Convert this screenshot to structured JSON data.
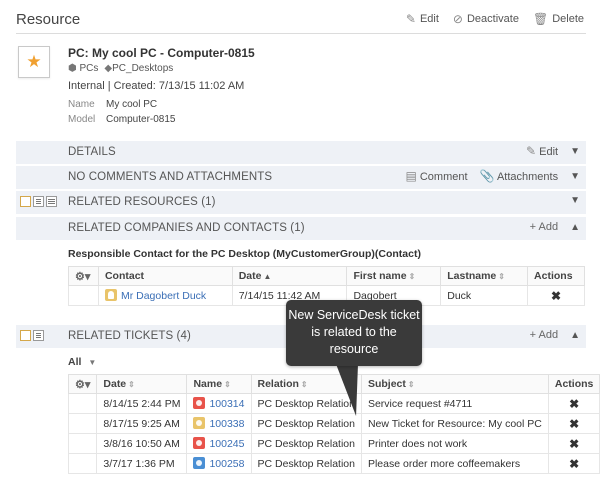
{
  "header": {
    "title": "Resource",
    "edit": "Edit",
    "deactivate": "Deactivate",
    "delete": "Delete"
  },
  "resource": {
    "title": "PC: My cool PC - Computer-0815",
    "crumb1": "PCs",
    "crumb2": "PC_Desktops",
    "meta": "Internal | Created: 7/13/15 11:02 AM",
    "name_label": "Name",
    "name_value": "My cool PC",
    "model_label": "Model",
    "model_value": "Computer-0815"
  },
  "sections": {
    "details": "DETAILS",
    "details_edit": "Edit",
    "comments": "NO COMMENTS AND ATTACHMENTS",
    "comment_btn": "Comment",
    "attachments_btn": "Attachments",
    "related_resources": "RELATED RESOURCES (1)",
    "related_companies": "RELATED COMPANIES AND CONTACTS (1)",
    "add": "+ Add",
    "related_tickets": "RELATED TICKETS (4)"
  },
  "contacts": {
    "subhead": "Responsible Contact for the PC Desktop (MyCustomerGroup)(Contact)",
    "columns": [
      "Contact",
      "Date",
      "First name",
      "Lastname",
      "Actions"
    ],
    "rows": [
      {
        "contact": "Mr Dagobert Duck",
        "date": "7/14/15 11:42 AM",
        "first": "Dagobert",
        "last": "Duck"
      }
    ]
  },
  "tickets": {
    "filter": "All",
    "columns": [
      "Date",
      "Name",
      "Relation",
      "Subject",
      "Actions"
    ],
    "rows": [
      {
        "date": "8/14/15 2:44 PM",
        "name": "100314",
        "relation": "PC Desktop Relation",
        "subject": "Service request #4711",
        "icon_color": "#e8534a"
      },
      {
        "date": "8/17/15 9:25 AM",
        "name": "100338",
        "relation": "PC Desktop Relation",
        "subject": "New Ticket for Resource: My cool PC",
        "icon_color": "#e9c46a"
      },
      {
        "date": "3/8/16 10:50 AM",
        "name": "100245",
        "relation": "PC Desktop Relation",
        "subject": "Printer does not work",
        "icon_color": "#e8534a"
      },
      {
        "date": "3/7/17 1:36 PM",
        "name": "100258",
        "relation": "PC Desktop Relation",
        "subject": "Please order more coffeemakers",
        "icon_color": "#4a8fd4"
      }
    ]
  },
  "callout": {
    "text": "New ServiceDesk ticket is related to the resource"
  }
}
